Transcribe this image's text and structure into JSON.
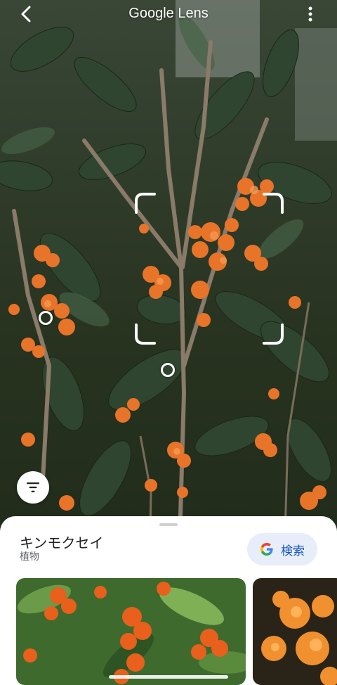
{
  "app": {
    "title": "Google Lens"
  },
  "icons": {
    "back": "back-arrow-icon",
    "menu": "more-vert-icon",
    "filter": "filter-icon",
    "google": "google-g-icon"
  },
  "result": {
    "name": "キンモクセイ",
    "category": "植物",
    "search_label": "検索"
  },
  "colors": {
    "accent": "#1a56c4",
    "search_pill": "#e8eef9",
    "flower_orange": "#e8742a",
    "foliage": "#2e3d2c"
  }
}
